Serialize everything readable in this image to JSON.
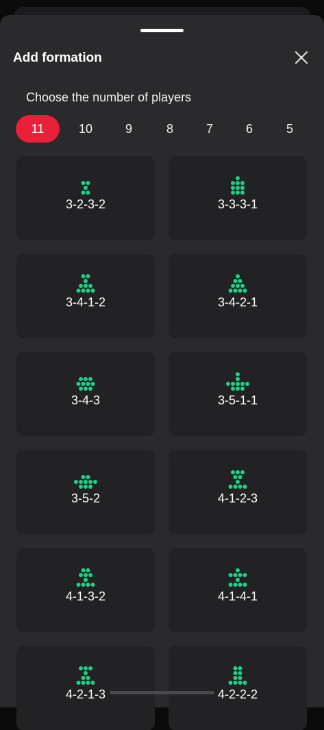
{
  "header": {
    "title": "Add formation"
  },
  "subtitle": "Choose the number of players",
  "player_counts": [
    "11",
    "10",
    "9",
    "8",
    "7",
    "6",
    "5"
  ],
  "selected_count": "11",
  "colors": {
    "accent": "#e8203a",
    "dot": "#1dd186",
    "card": "#222224",
    "sheet": "#2a2a2c"
  },
  "formations": [
    {
      "label": "3-2-3-2",
      "rows": [
        2,
        1,
        2
      ]
    },
    {
      "label": "3-3-3-1",
      "rows": [
        1,
        3,
        3,
        3
      ]
    },
    {
      "label": "3-4-1-2",
      "rows": [
        2,
        1,
        3,
        4
      ]
    },
    {
      "label": "3-4-2-1",
      "rows": [
        1,
        2,
        3,
        4
      ]
    },
    {
      "label": "3-4-3",
      "rows": [
        3,
        4,
        3
      ]
    },
    {
      "label": "3-5-1-1",
      "rows": [
        1,
        1,
        5,
        3
      ]
    },
    {
      "label": "3-5-2",
      "rows": [
        2,
        5,
        3
      ]
    },
    {
      "label": "4-1-2-3",
      "rows": [
        3,
        2,
        1,
        4
      ]
    },
    {
      "label": "4-1-3-2",
      "rows": [
        2,
        3,
        1,
        4
      ]
    },
    {
      "label": "4-1-4-1",
      "rows": [
        1,
        4,
        1,
        4
      ]
    },
    {
      "label": "4-2-1-3",
      "rows": [
        3,
        1,
        2,
        4
      ]
    },
    {
      "label": "4-2-2-2",
      "rows": [
        2,
        2,
        2,
        4
      ]
    }
  ]
}
